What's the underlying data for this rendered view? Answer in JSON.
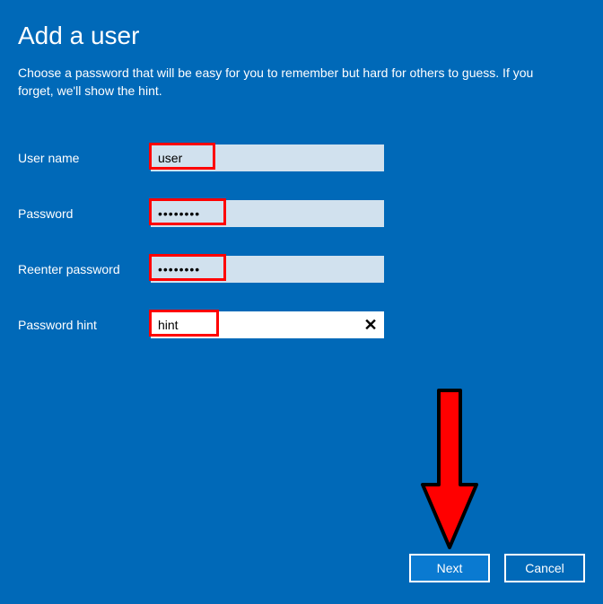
{
  "title": "Add a user",
  "description": "Choose a password that will be easy for you to remember but hard for others to guess. If you forget, we'll show the hint.",
  "labels": {
    "username": "User name",
    "password": "Password",
    "reenter": "Reenter password",
    "hint": "Password hint"
  },
  "values": {
    "username": "user",
    "password": "••••••••",
    "reenter": "••••••••",
    "hint": "hint"
  },
  "buttons": {
    "next": "Next",
    "cancel": "Cancel"
  },
  "highlights": {
    "username": true,
    "password": true,
    "reenter": true,
    "hint": true
  },
  "annotation": {
    "arrow_color": "#ff0000",
    "arrow_target": "next-button"
  }
}
